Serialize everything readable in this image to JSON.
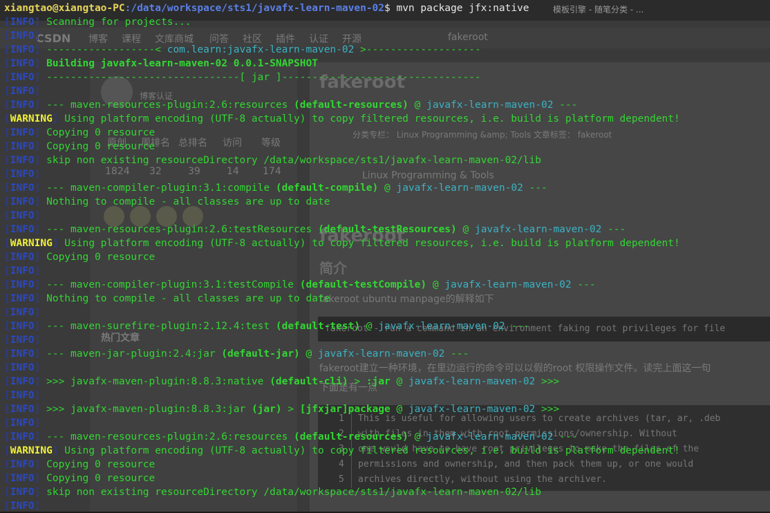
{
  "background_window": {
    "tabs": [
      "fakeroot",
      "模板引擎 - 随笔分类 - ..."
    ],
    "nav": [
      "CSDN",
      "博客",
      "课程",
      "文库商城",
      "问答",
      "社区",
      "插件",
      "认证",
      "开源"
    ],
    "page_tab": "fakeroot",
    "profile": {
      "badge": "博客认证",
      "stats_labels": [
        "原创",
        "周排名",
        "总排名",
        "访问",
        "等级"
      ],
      "stats_values": [
        "1824",
        "32",
        "39",
        "14",
        "174"
      ]
    },
    "article_title": "fakeroot",
    "tags_line": "分类专栏： Linux Programming &amp; Tools  文章标签： fakeroot",
    "column_name": "Linux Programming & Tools",
    "section_title": "fakeroot",
    "intro_heading": "简介",
    "intro_text": "fakeroot  ubuntu  manpage的解释如下",
    "code_bar_text": "fakeroot - run a command in an environment faking root privileges for file",
    "translation_text": "fakeroot建立一种环境，在里边运行的命令可以以假的root 权限操作文件。读完上面这一句",
    "next_heading": "下面是有一点",
    "hot_title": "热门文章",
    "code_lines": [
      "This  is useful for allowing users to create archives (tar, ar, .deb",
      "      with files in them with root permissions/ownership.  Without",
      "      one would have to have root privileges to make the files of the",
      "      permissions and ownership, and then pack them up, or  one  would",
      "      archives directly, without using the archiver."
    ],
    "line_numbers": [
      "1",
      "2",
      "3",
      "4",
      "5"
    ]
  },
  "terminal": {
    "prompt_user": "xiangtao@xiangtao-PC",
    "prompt_path": ":/data/workspace/sts1/javafx-learn-maven-02",
    "prompt_cmd": "$ mvn package jfx:native",
    "lines": [
      {
        "level": "INFO",
        "segs": [
          {
            "t": " Scanning for projects...",
            "c": "green"
          }
        ]
      },
      {
        "level": "INFO",
        "segs": []
      },
      {
        "level": "INFO",
        "segs": [
          {
            "t": " ------------------< ",
            "c": "green"
          },
          {
            "t": "com.learn:javafx-learn-maven-02",
            "c": "cyan"
          },
          {
            "t": " >-------------------",
            "c": "green"
          }
        ]
      },
      {
        "level": "INFO",
        "segs": [
          {
            "t": " Building javafx-learn-maven-02 0.0.1-SNAPSHOT",
            "c": "boldgreen"
          }
        ]
      },
      {
        "level": "INFO",
        "segs": [
          {
            "t": " --------------------------------[ jar ]---------------------------------",
            "c": "green"
          }
        ]
      },
      {
        "level": "INFO",
        "segs": []
      },
      {
        "level": "INFO",
        "segs": [
          {
            "t": " --- maven-resources-plugin:2.6:resources ",
            "c": "green"
          },
          {
            "t": "(default-resources)",
            "c": "boldgreen"
          },
          {
            "t": " @ ",
            "c": "green"
          },
          {
            "t": "javafx-learn-maven-02",
            "c": "cyan"
          },
          {
            "t": " ---",
            "c": "green"
          }
        ]
      },
      {
        "level": "WARNING",
        "segs": [
          {
            "t": " Using platform encoding (UTF-8 actually) to copy filtered resources, i.e. build is platform dependent!",
            "c": "green"
          }
        ]
      },
      {
        "level": "INFO",
        "segs": [
          {
            "t": " Copying 0 resource",
            "c": "green"
          }
        ]
      },
      {
        "level": "INFO",
        "segs": [
          {
            "t": " Copying 0 resource",
            "c": "green"
          }
        ]
      },
      {
        "level": "INFO",
        "segs": [
          {
            "t": " skip non existing resourceDirectory /data/workspace/sts1/javafx-learn-maven-02/lib",
            "c": "green"
          }
        ]
      },
      {
        "level": "INFO",
        "segs": []
      },
      {
        "level": "INFO",
        "segs": [
          {
            "t": " --- maven-compiler-plugin:3.1:compile ",
            "c": "green"
          },
          {
            "t": "(default-compile)",
            "c": "boldgreen"
          },
          {
            "t": " @ ",
            "c": "green"
          },
          {
            "t": "javafx-learn-maven-02",
            "c": "cyan"
          },
          {
            "t": " ---",
            "c": "green"
          }
        ]
      },
      {
        "level": "INFO",
        "segs": [
          {
            "t": " Nothing to compile - all classes are up to date",
            "c": "green"
          }
        ]
      },
      {
        "level": "INFO",
        "segs": []
      },
      {
        "level": "INFO",
        "segs": [
          {
            "t": " --- maven-resources-plugin:2.6:testResources ",
            "c": "green"
          },
          {
            "t": "(default-testResources)",
            "c": "boldgreen"
          },
          {
            "t": " @ ",
            "c": "green"
          },
          {
            "t": "javafx-learn-maven-02",
            "c": "cyan"
          },
          {
            "t": " ---",
            "c": "green"
          }
        ]
      },
      {
        "level": "WARNING",
        "segs": [
          {
            "t": " Using platform encoding (UTF-8 actually) to copy filtered resources, i.e. build is platform dependent!",
            "c": "green"
          }
        ]
      },
      {
        "level": "INFO",
        "segs": [
          {
            "t": " Copying 0 resource",
            "c": "green"
          }
        ]
      },
      {
        "level": "INFO",
        "segs": []
      },
      {
        "level": "INFO",
        "segs": [
          {
            "t": " --- maven-compiler-plugin:3.1:testCompile ",
            "c": "green"
          },
          {
            "t": "(default-testCompile)",
            "c": "boldgreen"
          },
          {
            "t": " @ ",
            "c": "green"
          },
          {
            "t": "javafx-learn-maven-02",
            "c": "cyan"
          },
          {
            "t": " ---",
            "c": "green"
          }
        ]
      },
      {
        "level": "INFO",
        "segs": [
          {
            "t": " Nothing to compile - all classes are up to date",
            "c": "green"
          }
        ]
      },
      {
        "level": "INFO",
        "segs": []
      },
      {
        "level": "INFO",
        "segs": [
          {
            "t": " --- maven-surefire-plugin:2.12.4:test ",
            "c": "green"
          },
          {
            "t": "(default-test)",
            "c": "boldgreen"
          },
          {
            "t": " @ ",
            "c": "green"
          },
          {
            "t": "javafx-learn-maven-02",
            "c": "cyan"
          },
          {
            "t": " ---",
            "c": "green"
          }
        ]
      },
      {
        "level": "INFO",
        "segs": []
      },
      {
        "level": "INFO",
        "segs": [
          {
            "t": " --- maven-jar-plugin:2.4:jar ",
            "c": "green"
          },
          {
            "t": "(default-jar)",
            "c": "boldgreen"
          },
          {
            "t": " @ ",
            "c": "green"
          },
          {
            "t": "javafx-learn-maven-02",
            "c": "cyan"
          },
          {
            "t": " ---",
            "c": "green"
          }
        ]
      },
      {
        "level": "INFO",
        "segs": []
      },
      {
        "level": "INFO",
        "segs": [
          {
            "t": " >>> javafx-maven-plugin:8.8.3:native ",
            "c": "green"
          },
          {
            "t": "(default-cli)",
            "c": "boldgreen"
          },
          {
            "t": " > ",
            "c": "green"
          },
          {
            "t": ":jar",
            "c": "boldgreen"
          },
          {
            "t": " @ ",
            "c": "green"
          },
          {
            "t": "javafx-learn-maven-02",
            "c": "cyan"
          },
          {
            "t": " >>>",
            "c": "green"
          }
        ]
      },
      {
        "level": "INFO",
        "segs": []
      },
      {
        "level": "INFO",
        "segs": [
          {
            "t": " >>> javafx-maven-plugin:8.8.3:jar ",
            "c": "green"
          },
          {
            "t": "(jar)",
            "c": "boldgreen"
          },
          {
            "t": " > ",
            "c": "green"
          },
          {
            "t": "[jfxjar]package",
            "c": "boldgreen"
          },
          {
            "t": " @ ",
            "c": "green"
          },
          {
            "t": "javafx-learn-maven-02",
            "c": "cyan"
          },
          {
            "t": " >>>",
            "c": "green"
          }
        ]
      },
      {
        "level": "INFO",
        "segs": []
      },
      {
        "level": "INFO",
        "segs": [
          {
            "t": " --- maven-resources-plugin:2.6:resources ",
            "c": "green"
          },
          {
            "t": "(default-resources)",
            "c": "boldgreen"
          },
          {
            "t": " @ ",
            "c": "green"
          },
          {
            "t": "javafx-learn-maven-02",
            "c": "cyan"
          },
          {
            "t": " ---",
            "c": "green"
          }
        ]
      },
      {
        "level": "WARNING",
        "segs": [
          {
            "t": " Using platform encoding (UTF-8 actually) to copy filtered resources, i.e. build is platform dependent!",
            "c": "green"
          }
        ]
      },
      {
        "level": "INFO",
        "segs": [
          {
            "t": " Copying 0 resource",
            "c": "green"
          }
        ]
      },
      {
        "level": "INFO",
        "segs": [
          {
            "t": " Copying 0 resource",
            "c": "green"
          }
        ]
      },
      {
        "level": "INFO",
        "segs": [
          {
            "t": " skip non existing resourceDirectory /data/workspace/sts1/javafx-learn-maven-02/lib",
            "c": "green"
          }
        ]
      },
      {
        "level": "INFO",
        "segs": []
      }
    ]
  }
}
